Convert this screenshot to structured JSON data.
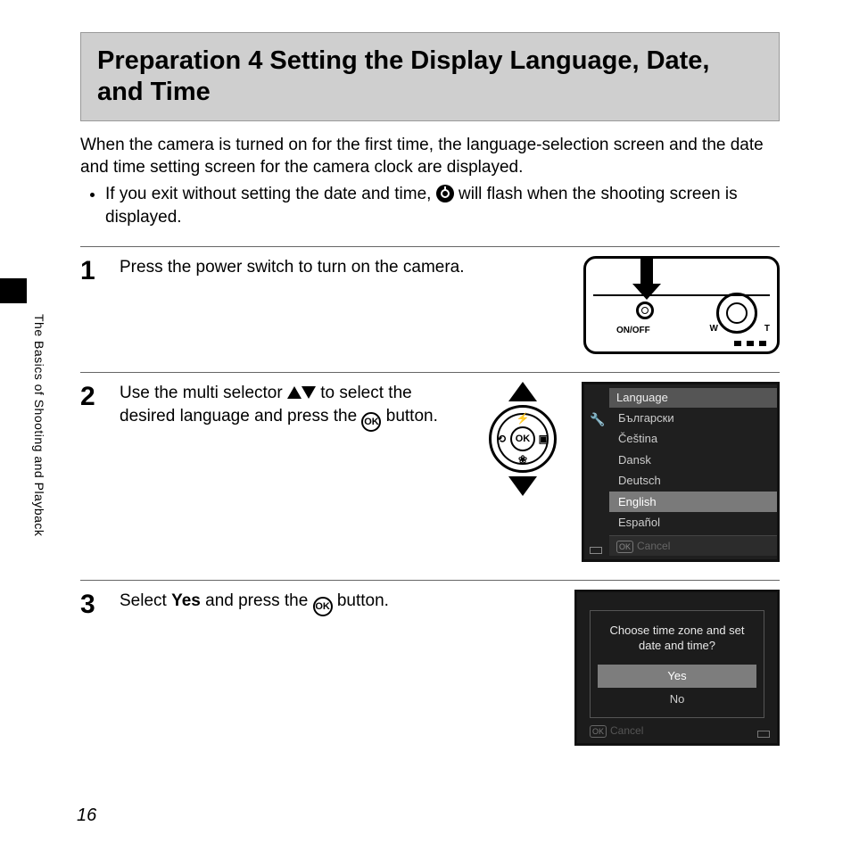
{
  "page_number": "16",
  "side_tab": "The Basics of Shooting and Playback",
  "title": "Preparation 4 Setting the Display Language, Date, and Time",
  "intro_p": "When the camera is turned on for the first time, the language-selection screen and the date and time setting screen for the camera clock are displayed.",
  "intro_bullet_pre": "If you exit without setting the date and time, ",
  "intro_bullet_post": " will flash when the shooting screen is displayed.",
  "steps": {
    "s1": {
      "num": "1",
      "text": "Press the power switch to turn on the camera."
    },
    "s2": {
      "num": "2",
      "pre": "Use the multi selector ",
      "mid": " to select the desired language and press the ",
      "post": " button."
    },
    "s3": {
      "num": "3",
      "pre": "Select ",
      "bold": "Yes",
      "mid": " and press the ",
      "post": " button."
    }
  },
  "cam_labels": {
    "onoff": "ON/OFF",
    "w": "W",
    "t": "T"
  },
  "ok_label": "OK",
  "dpad": {
    "top": "⚡",
    "bottom": "❀",
    "left": "⟲",
    "right": "▣"
  },
  "lang_screen": {
    "header": "Language",
    "items": [
      "Български",
      "Čeština",
      "Dansk",
      "Deutsch",
      "English",
      "Español"
    ],
    "selected_index": 4,
    "cancel": "Cancel",
    "tool": "🔧"
  },
  "confirm_screen": {
    "msg": "Choose time zone and set date and time?",
    "yes": "Yes",
    "no": "No",
    "cancel": "Cancel"
  }
}
